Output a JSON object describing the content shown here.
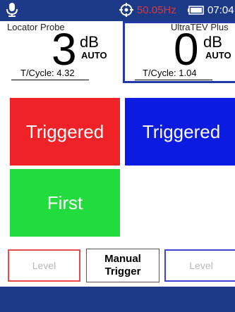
{
  "statusbar": {
    "frequency": "50.05Hz",
    "time": "07:04",
    "icons": [
      "microphone-icon",
      "target-icon",
      "battery-icon"
    ],
    "frequency_color": "#d8383a"
  },
  "channels": [
    {
      "probe": "Locator Probe",
      "value": "3",
      "unit": "dB",
      "mode": "AUTO",
      "cycle_label": "T/Cycle: 4.32",
      "accent": "#ee2227"
    },
    {
      "probe": "UltraTEV Plus",
      "value": "0",
      "unit": "dB",
      "mode": "AUTO",
      "cycle_label": "T/Cycle: 1.04",
      "accent": "#1f3aa7"
    }
  ],
  "tiles": {
    "red": "Triggered",
    "blue": "Triggered",
    "green": "First"
  },
  "buttons": {
    "level_left": "Level",
    "manual_line1": "Manual",
    "manual_line2": "Trigger",
    "level_right": "Level"
  }
}
